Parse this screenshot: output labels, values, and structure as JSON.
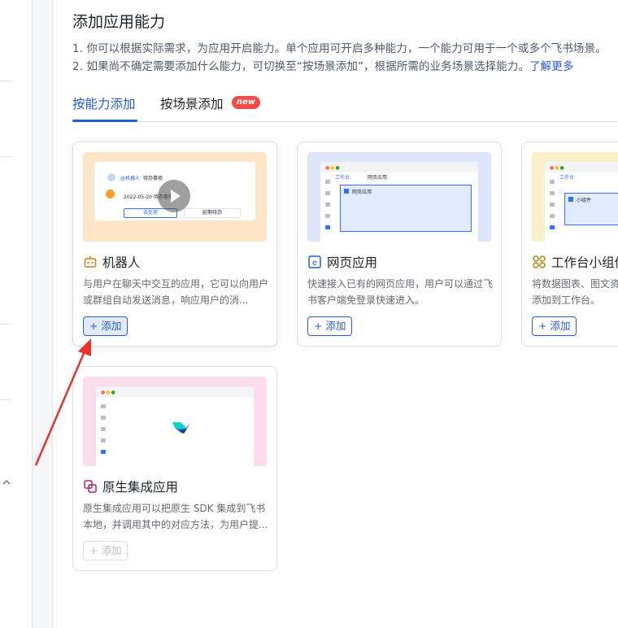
{
  "page": {
    "title": "添加应用能力",
    "desc_line1": "1. 你可以根据实际需求，为应用开启能力。单个应用可开启多种能力，一个能力可用于一个或多个飞书场景。",
    "desc_line2": "2. 如果尚不确定需要添加什么能力，可切换至“按场景添加”，根据所需的业务场景选择能力。",
    "learn_more": "了解更多"
  },
  "tabs": [
    {
      "label": "按能力添加",
      "active": true
    },
    {
      "label": "按场景添加",
      "active": false
    }
  ],
  "new_badge": "new",
  "colors": {
    "accent": "#245bdb",
    "badge": "#f54a45",
    "bot_thumb_bg": "#fde6c8",
    "web_thumb_bg": "#dde6fc",
    "widget_thumb_bg": "#faf0c8",
    "native_thumb_bg": "#fbdcea"
  },
  "cards": [
    {
      "name": "机器人",
      "icon": "robot-icon",
      "desc": "与用户在聊天中交互的应用，它可以向用户或群组自动发送消息，响应用户的消...",
      "add_label": "添加",
      "state": "active",
      "thumb": {
        "bot_name": "@机器人",
        "todo": "待办事项",
        "date_line": "2022-05-20 待办事项",
        "btn_left": "去处理",
        "btn_right": "延期待办"
      }
    },
    {
      "name": "网页应用",
      "icon": "web-app-icon",
      "desc": "快速接入已有的网页应用，用户可以通过飞书客户端免登录快速进入。",
      "add_label": "添加",
      "state": "normal",
      "thumb": {
        "tab_label": "工作台",
        "tab_label2": "网页应用",
        "frame_label": "网页应用"
      }
    },
    {
      "name": "工作台小组件",
      "icon": "widget-icon",
      "desc": "将数据图表、图文资讯等内容以小组件形式添加到工作台。",
      "add_label": "添加",
      "state": "normal",
      "thumb": {
        "tab_label": "工作台",
        "frame_label": "小组件"
      }
    },
    {
      "name": "原生集成应用",
      "icon": "native-app-icon",
      "desc": "原生集成应用可以把原生 SDK 集成到飞书本地，并调用其中的对应方法，为用户提...",
      "add_label": "添加",
      "state": "disabled"
    }
  ]
}
